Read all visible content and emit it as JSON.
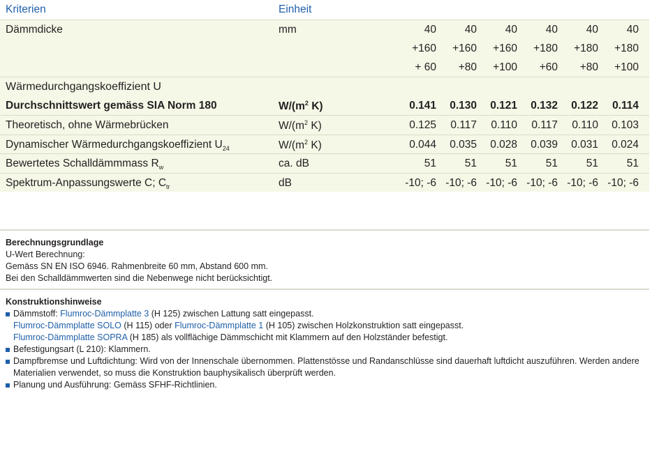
{
  "header": {
    "criteria": "Kriterien",
    "unit": "Einheit"
  },
  "rows": [
    {
      "label": "Dämmdicke",
      "unit": "mm",
      "values": [
        "40",
        "40",
        "40",
        "40",
        "40",
        "40"
      ]
    },
    {
      "label": "",
      "unit": "",
      "values": [
        "+160",
        "+160",
        "+160",
        "+180",
        "+180",
        "+180"
      ]
    },
    {
      "label": "",
      "unit": "",
      "values": [
        "+ 60",
        "+80",
        "+100",
        "+60",
        "+80",
        "+100"
      ]
    },
    {
      "label": "Wärmedurchgangskoeffizient U",
      "unit": "",
      "values": []
    },
    {
      "label": "Durchschnittswert gemäss SIA Norm 180",
      "unit_base": "W/(m",
      "unit_sup": "2",
      "unit_end": " K)",
      "values": [
        "0.141",
        "0.130",
        "0.121",
        "0.132",
        "0.122",
        "0.114"
      ]
    },
    {
      "label": "Theoretisch, ohne Wärmebrücken",
      "unit_base": "W/(m",
      "unit_sup": "2",
      "unit_end": " K)",
      "values": [
        "0.125",
        "0.117",
        "0.110",
        "0.117",
        "0.110",
        "0.103"
      ]
    },
    {
      "label_base": "Dynamischer Wärmedurchgangskoeffizient U",
      "label_sub": "24",
      "unit_base": "W/(m",
      "unit_sup": "2",
      "unit_end": " K)",
      "values": [
        "0.044",
        "0.035",
        "0.028",
        "0.039",
        "0.031",
        "0.024"
      ]
    },
    {
      "label_base": "Bewertetes Schalldämmmass R",
      "label_sub": "w",
      "unit": "ca. dB",
      "values": [
        "51",
        "51",
        "51",
        "51",
        "51",
        "51"
      ]
    },
    {
      "label_base": "Spektrum-Anpassungswerte C; C",
      "label_sub": "tr",
      "unit": "dB",
      "values": [
        "-10; -6",
        "-10; -6",
        "-10; -6",
        "-10; -6",
        "-10; -6",
        "-10; -6"
      ]
    }
  ],
  "berechnung": {
    "title": "Berechnungsgrundlage",
    "lines": [
      "U-Wert Berechnung:",
      "Gemäss SN EN ISO 6946. Rahmenbreite 60 mm, Abstand 600 mm.",
      "Bei den Schalldämmwerten sind die Nebenwege nicht berücksichtigt."
    ]
  },
  "konstruktion": {
    "title": "Konstruktionshinweise",
    "b1_pre": "Dämmstoff: ",
    "b1_link": "Flumroc-Dämmplatte 3",
    "b1_post": " (H 125) zwischen Lattung satt eingepasst.",
    "b1_l2_link1": "Flumroc-Dämmplatte SOLO",
    "b1_l2_mid": " (H 115) oder ",
    "b1_l2_link2": "Flumroc-Dämmplatte 1",
    "b1_l2_post": " (H 105) zwischen Holzkonstruktion satt eingepasst.",
    "b1_l3_link": "Flumroc-Dämmplatte SOPRA",
    "b1_l3_post": " (H 185) als vollflächige Dämmschicht mit Klammern auf den Holzständer befestigt.",
    "b2": "Befestigungsart (L 210): Klammern.",
    "b3_l1": "Dampfbremse und Luftdichtung: Wird von der Innenschale übernommen. Plattenstösse und Randanschlüsse sind dauerhaft luftdicht auszuführen. Werden andere",
    "b3_l2": "Materialien verwendet, so muss die Konstruktion bauphysikalisch überprüft werden.",
    "b4": "Planung und Ausführung: Gemäss SFHF-Richtlinien."
  },
  "colors": {
    "accent": "#1f5fa8",
    "table_bg": "#f5f7e7",
    "text": "#231f20"
  }
}
